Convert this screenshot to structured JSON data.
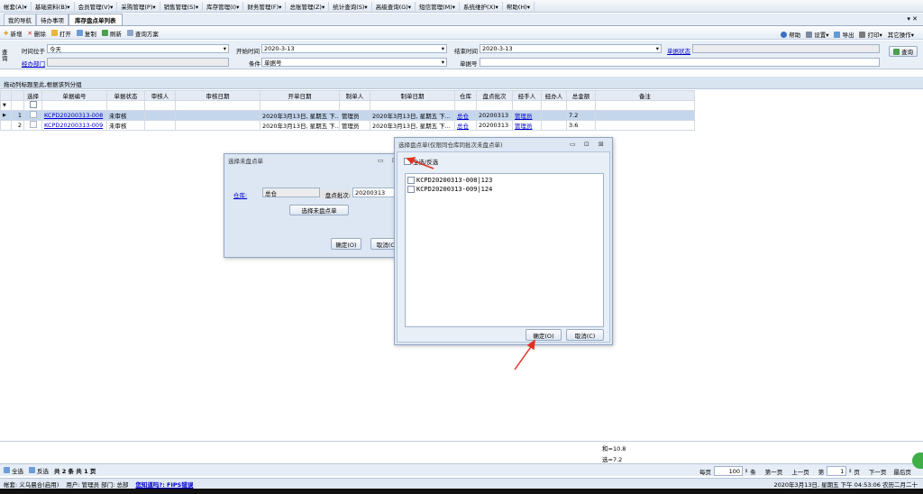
{
  "menu": [
    "帐套(A)▾",
    "基础资料(B)▾",
    "会员管理(V)▾",
    "采购管理(P)▾",
    "销售管理(S)▾",
    "库存管理(I)▾",
    "财务管理(F)▾",
    "总账管理(Z)▾",
    "统计查询(S)▾",
    "高级查询(G)▾",
    "短信管理(M)▾",
    "系统维护(X)▾",
    "帮助(H)▾"
  ],
  "tabs": [
    "我的导航",
    "待办事项",
    "库存盘点单列表"
  ],
  "toolbar": {
    "new": "新增",
    "delete": "删除",
    "open": "打开",
    "copy": "复制",
    "refresh": "刷新",
    "query_plan": "查询方案",
    "help": "帮助",
    "settings": "设置▾",
    "export": "导出",
    "print": "打印▾",
    "other": "其它操作▾"
  },
  "query": {
    "side_label": "查询",
    "time_label": "时间位于",
    "time_value": "今天",
    "start_label": "开始时间",
    "start_value": "2020-3-13",
    "end_label": "结束时间",
    "end_value": "2020-3-13",
    "status_label": "单据状态",
    "handler_label": "经办部门",
    "cond_label": "条件",
    "cond_value": "单据号",
    "docno_label": "单据号",
    "query_btn": "查询"
  },
  "group_hint": "拖动列标题至此,根据该列分组",
  "grid": {
    "headers": [
      "选择",
      "单据编号",
      "单据状态",
      "审核人",
      "审核日期",
      "开单日期",
      "制单人",
      "制单日期",
      "仓库",
      "盘点批次",
      "经手人",
      "经办人",
      "总金额",
      "备注"
    ],
    "rows": [
      {
        "no": "1",
        "code": "KCPD20200313-008",
        "status": "未审核",
        "auditor": "",
        "audit_date": "",
        "open_date": "2020年3月13日, 星期五 下...",
        "maker": "管理员",
        "make_date": "2020年3月13日, 星期五 下...",
        "warehouse": "总仓",
        "batch": "20200313",
        "handler": "管理员",
        "agent": "",
        "amount": "7.2",
        "remark": ""
      },
      {
        "no": "2",
        "code": "KCPD20200313-009",
        "status": "未审核",
        "auditor": "",
        "audit_date": "",
        "open_date": "2020年3月13日, 星期五 下...",
        "maker": "管理员",
        "make_date": "2020年3月13日, 星期五 下...",
        "warehouse": "总仓",
        "batch": "20200313",
        "handler": "管理员",
        "agent": "",
        "amount": "3.6",
        "remark": ""
      }
    ],
    "sum1": "和=10.8",
    "sum2": "选=7.2"
  },
  "dlg1": {
    "title": "选择未盘点单",
    "warehouse_label": "仓库:",
    "warehouse_value": "总仓",
    "batch_label": "盘点批次:",
    "batch_value": "20200313",
    "select_btn": "选择未盘点单",
    "ok": "确定(O)",
    "cancel": "取消(C)"
  },
  "dlg2": {
    "title": "选择盘点单(仅限同仓库同批次未盘点单)",
    "select_all": "全选/反选",
    "items": [
      "KCPD20200313-008|123",
      "KCPD20200313-009|124"
    ],
    "ok": "确定(O)",
    "cancel": "取消(C)"
  },
  "pager": {
    "select_all": "全选",
    "invert": "反选",
    "summary": "共 2 条  共 1 页",
    "per_page": "每页",
    "per_value": "100",
    "unit": "条",
    "first": "第一页",
    "prev": "上一页",
    "page_label": "第",
    "page_value": "1",
    "page_unit": "页",
    "next": "下一页",
    "last": "最后页"
  },
  "status": {
    "account": "帐套: 义乌晨合(启用)",
    "user": "用户: 管理员  部门: 总部",
    "link": "您知道吗?: FIPS错误",
    "datetime": "2020年3月13日, 星期五 下午 04:53:06 农历二月二十"
  },
  "colors": {
    "arrow": "#e0311f",
    "accent": "#d9e4f1"
  }
}
